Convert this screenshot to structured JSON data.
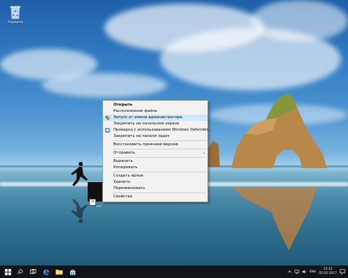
{
  "desktop": {
    "icons": [
      {
        "label": "Корзина",
        "icon": "recycle-bin-icon"
      }
    ],
    "shortcut": {
      "label": "ssd",
      "icon": "shortcut-icon"
    }
  },
  "context_menu": {
    "items": [
      {
        "label": "Открыть",
        "bold": true,
        "highlighted": false,
        "icon": null
      },
      {
        "label": "Расположение файла",
        "bold": false,
        "highlighted": false,
        "icon": null
      },
      {
        "label": "Запуск от имени администратора",
        "bold": false,
        "highlighted": true,
        "icon": "uac-shield-icon"
      },
      {
        "label": "Закрепить на начальном экране",
        "bold": false,
        "highlighted": false,
        "icon": null
      },
      {
        "label": "Проверка с использованием Windows Defender...",
        "bold": false,
        "highlighted": false,
        "icon": "defender-icon"
      },
      {
        "label": "Закрепить на панели задач",
        "bold": false,
        "highlighted": false,
        "icon": null
      },
      {
        "label": "Восстановить прежнюю версию",
        "bold": false,
        "highlighted": false,
        "icon": null
      },
      {
        "label": "Отправить",
        "bold": false,
        "highlighted": false,
        "icon": null,
        "submenu": true
      },
      {
        "label": "Вырезать",
        "bold": false,
        "highlighted": false,
        "icon": null
      },
      {
        "label": "Копировать",
        "bold": false,
        "highlighted": false,
        "icon": null
      },
      {
        "label": "Создать ярлык",
        "bold": false,
        "highlighted": false,
        "icon": null
      },
      {
        "label": "Удалить",
        "bold": false,
        "highlighted": false,
        "icon": null
      },
      {
        "label": "Переименовать",
        "bold": false,
        "highlighted": false,
        "icon": null
      },
      {
        "label": "Свойства",
        "bold": false,
        "highlighted": false,
        "icon": null
      }
    ],
    "highlight_color": "#cde8ff",
    "background_color": "#f2f2f2"
  },
  "taskbar": {
    "buttons": [
      {
        "icon": "windows-start-icon"
      },
      {
        "icon": "search-icon"
      },
      {
        "icon": "task-view-icon"
      },
      {
        "icon": "edge-browser-icon"
      },
      {
        "icon": "file-explorer-icon"
      },
      {
        "icon": "store-icon"
      }
    ],
    "tray": {
      "icons": [
        "chevron-up-icon",
        "network-icon",
        "volume-icon"
      ],
      "language": "ENG",
      "time": "15:12",
      "date": "05.02.2017"
    },
    "background_color": "#101418"
  }
}
